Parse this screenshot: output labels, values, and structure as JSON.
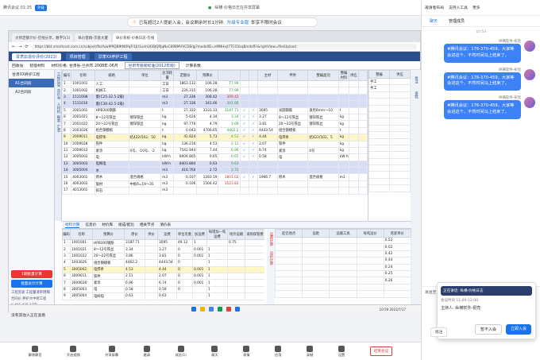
{
  "meeting": {
    "app_title": "腾讯会议 01:35",
    "mode_badge": "外链",
    "title": "纵横·价格日志在共享屏幕",
    "status_dot": "●"
  },
  "banner": {
    "text": "已有超过2人提前入会，会议剩余时长1分钟.",
    "link": "升级专业版",
    "suffix": "即享不限时会议"
  },
  "browser": {
    "tabs": [
      "大师定额计价-在线分享，数字5(1)",
      "纵价客群-京基大厦",
      "纵价系统-价格日志-在线"
    ],
    "url": "https://bbt.smartcost.com.cn/subject/fkzYuw9f9QB9tNOfqFr1JU1unhUG8JQRJqNxC89BMVVCDB/gj?modelID=nMNHxjt7TCO1kqBmdxfFr&rightView=file/Upload",
    "app_tabs": [
      "甘肃云造价评价(2021)",
      "项目管理",
      "甘肃XX养护工程"
    ],
    "toolbar": {
      "items": [
        "回收站",
        "智能材料",
        "材料价格: 甘肃省-兰州市 2008年-06月",
        "计算系数"
      ],
      "selector": "甘肃专版新标准(2012年版)"
    }
  },
  "left_panel": {
    "nodes": [
      "甘肃XX养护工程",
      "A1合同段",
      "A2合同段"
    ],
    "vtabs": [
      "工程信息",
      "造价书",
      "人材机",
      "报表",
      "汇总"
    ],
    "buttons": {
      "bind": "1期批量计算",
      "batch": "批量总计计算"
    },
    "info": [
      "工程资源 工程量清单明细",
      "合同价 养护大中修工程",
      "¥ 401,425.17元"
    ],
    "tip": "没有其他人正在查看"
  },
  "grid": {
    "headers": [
      "编号",
      "名称",
      "规格",
      "单位",
      "总消耗量",
      "定额价",
      "预算价",
      "",
      "",
      "",
      "主材",
      "甲供",
      "整编类别",
      "整编材料",
      "供应"
    ],
    "rows": [
      {
        "cls": "",
        "c": [
          "1",
          "1001001",
          "人工",
          "",
          "工日",
          "1863.132",
          "106.28",
          "77.99",
          "",
          "",
          "",
          "",
          "",
          "",
          "",
          ""
        ]
      },
      {
        "cls": "",
        "c": [
          "2",
          "1001002",
          "机械工",
          "",
          "工日",
          "226.315",
          "106.28",
          "77.99",
          "",
          "",
          "",
          "",
          "",
          "",
          "",
          ""
        ]
      },
      {
        "cls": "pur",
        "c": [
          "3",
          "1511008",
          "菱(C25-32.5-2级)",
          "",
          "m3",
          "27.336",
          "308.42",
          "309.42",
          "",
          "",
          "",
          "",
          "",
          "",
          "",
          ""
        ]
      },
      {
        "cls": "pur",
        "c": [
          "4",
          "1511010",
          "菱(C30-42.5-2级)",
          "",
          "m3",
          "27.336",
          "341.66",
          "341.66",
          "",
          "",
          "",
          "",
          "",
          "",
          "",
          ""
        ]
      },
      {
        "cls": "",
        "c": [
          "5",
          "2001001",
          "HPB300钢筋",
          "",
          "t",
          "27.332",
          "3333.33",
          "3187.71",
          "✓",
          "✓",
          "3095",
          "光圆钢筋",
          "直径8mm～10",
          "t",
          "",
          ""
        ]
      },
      {
        "cls": "",
        "c": [
          "6",
          "2001021",
          "8～12号铁丝",
          "镀锌铁丝",
          "kg",
          "5.626",
          "4.34",
          "3.34",
          "✓",
          "✓",
          "3.27",
          "8～12号铁丝",
          "镀锌铁丝",
          "kg",
          "",
          ""
        ]
      },
      {
        "cls": "",
        "c": [
          "7",
          "2001022",
          "20～22号铁丝",
          "镀锌铁丝",
          "kg",
          "97.770",
          "4.79",
          "3.69",
          "✓",
          "✓",
          "3.81",
          "20～22号铁丝",
          "镀锌铁丝",
          "kg",
          "",
          ""
        ]
      },
      {
        "cls": "",
        "c": [
          "8",
          "2003026",
          "组合钢模板",
          "",
          "t",
          "0.043",
          "4706.65",
          "4462.2",
          "✓",
          "✓",
          "4443.54",
          "组合钢模板",
          "",
          "t",
          "",
          ""
        ]
      },
      {
        "cls": "yel",
        "c": [
          "9",
          "2009011",
          "电焊条",
          "结422(502、50",
          "kg",
          "41.824",
          "5.73",
          "4.53",
          "✓",
          "✓",
          "4.44",
          "电焊条",
          "结422(502、5",
          "kg",
          "",
          ""
        ]
      },
      {
        "cls": "",
        "c": [
          "10",
          "2009028",
          "铁件",
          "",
          "kg",
          "136.216",
          "4.53",
          "2.11",
          "✓",
          "✓",
          "2.07",
          "铁件",
          "",
          "kg",
          "",
          ""
        ]
      },
      {
        "cls": "",
        "c": [
          "11",
          "2009033",
          "紧涂",
          "0号、-10号、-2",
          "kg",
          "7541.944",
          "7.44",
          "6.96",
          "✓",
          "✓",
          "6.74",
          "紧涂",
          "0号",
          "kg",
          "",
          ""
        ]
      },
      {
        "cls": "",
        "c": [
          "12",
          "3005002",
          "电",
          "",
          "kW·h",
          "8004.805",
          "0.65",
          "0.65",
          "✓",
          "✓",
          "0.58",
          "电",
          "",
          "kW·h",
          "",
          ""
        ]
      },
      {
        "cls": "pur",
        "c": [
          "13",
          "3005003",
          "电网电",
          "",
          "kW·h",
          "8403.884",
          "0.63",
          "0.63",
          "",
          "",
          "",
          "",
          "",
          "",
          "",
          ""
        ]
      },
      {
        "cls": "pur",
        "c": [
          "14",
          "3005004",
          "水",
          "",
          "m3",
          "416.760",
          "2.72",
          "2.72",
          "",
          "",
          "",
          "",
          "",
          "",
          "",
          ""
        ]
      },
      {
        "cls": "",
        "c": [
          "15",
          "4003001",
          "原木",
          "混合规格",
          "m3",
          "0.107",
          "1283.19",
          "1801.02",
          "✓",
          "✓",
          "1966.7",
          "原木",
          "混合规格",
          "m3",
          "",
          ""
        ]
      },
      {
        "cls": "",
        "c": [
          "16",
          "4003002",
          "锯材",
          "中板δ=19～35",
          "m3",
          "0.106",
          "1504.42",
          "1523.83",
          "",
          "",
          "",
          "",
          "",
          "",
          "",
          ""
        ]
      },
      {
        "cls": "",
        "c": [
          "17",
          "4013001",
          "碎石",
          "",
          "m3",
          "",
          "",
          "",
          "",
          "",
          "",
          "",
          "",
          "",
          "",
          ""
        ]
      }
    ]
  },
  "right_grid": {
    "headers": [
      "整编",
      "供应"
    ],
    "rows": [
      [
        "手工",
        ""
      ],
      [
        "手工",
        ""
      ],
      [
        "",
        ""
      ],
      [
        "",
        ""
      ],
      [
        "",
        ""
      ],
      [
        "",
        ""
      ],
      [
        "",
        ""
      ],
      [
        "",
        ""
      ],
      [
        "",
        ""
      ],
      [
        "",
        ""
      ],
      [
        "",
        ""
      ],
      [
        "",
        ""
      ],
      [
        "",
        ""
      ],
      [
        "",
        ""
      ],
      [
        "",
        ""
      ],
      [
        "",
        ""
      ],
      [
        "",
        ""
      ]
    ]
  },
  "right_sidebar": [
    "批注",
    "查找"
  ],
  "subtabs": [
    "材料计算",
    "信息价",
    "材价库",
    "组成/配比",
    "相关节点",
    "清价表"
  ],
  "subgrid": {
    "headers": [
      "编码",
      "名称",
      "预算价",
      "原价",
      "供价",
      "运费",
      "单位毛重",
      "加运费",
      "每增加一吨运费",
      "场外运输",
      "采购保管费"
    ],
    "rows": [
      [
        "1",
        "1001001",
        "HPB300钢筋",
        "3187.71",
        "",
        "3095",
        "49.12",
        "1",
        "",
        "0.75",
        ""
      ],
      [
        "2",
        "1001021",
        "8～12号铁丝",
        "3.34",
        "",
        "3.27",
        "0",
        "0.001",
        "1",
        "",
        ""
      ],
      [
        "3",
        "1001022",
        "20～22号铁丝",
        "3.86",
        "",
        "3.81",
        "0",
        "0.001",
        "1",
        "",
        ""
      ],
      [
        "4",
        "1003026",
        "组合钢模板",
        "4462.2",
        "",
        "4443.54",
        "0",
        "",
        "1",
        "",
        ""
      ],
      [
        "5",
        "3005002",
        "电焊条",
        "4.53",
        "",
        "4.44",
        "0",
        "0.001",
        "1",
        "",
        ""
      ],
      [
        "6",
        "3009011",
        "铁件",
        "2.11",
        "",
        "2.07",
        "0",
        "0.001",
        "1",
        "",
        ""
      ],
      [
        "7",
        "3009028",
        "紧涂",
        "6.96",
        "",
        "6.74",
        "0",
        "0.001",
        "1",
        "",
        ""
      ],
      [
        "8",
        "3005003",
        "电",
        "0.58",
        "",
        "0.58",
        "0",
        "",
        "1",
        "",
        ""
      ],
      [
        "9",
        "3005004",
        "电网电",
        "0.63",
        "",
        "0.63",
        "",
        "",
        "1",
        "",
        ""
      ]
    ]
  },
  "subside": [
    "运费计算",
    "运价计算"
  ],
  "subright": {
    "headers": [
      "起讫地点",
      "运距",
      "运输工具",
      "每吨运价",
      "装卸单价"
    ],
    "rows": [
      [
        "",
        "",
        "",
        "",
        "0.52"
      ],
      [
        "",
        "",
        "",
        "",
        "0.02"
      ],
      [
        "",
        "",
        "",
        "",
        "0.42"
      ],
      [
        "",
        "",
        "",
        "",
        "0.44"
      ],
      [
        "",
        "",
        "",
        "",
        "0.24"
      ],
      [
        "",
        "",
        "",
        "",
        "0.25"
      ],
      [
        "",
        "",
        "",
        "",
        "0.26"
      ],
      [
        "",
        "",
        "",
        "",
        ""
      ],
      [
        "",
        "",
        "",
        "",
        ""
      ]
    ]
  },
  "taskbar": {
    "time": "10:59",
    "date": "2023/7/17"
  },
  "chat": {
    "top": [
      "邀请者布局",
      "支持人工具",
      "更多"
    ],
    "tabs": [
      "聊天",
      "管理成员"
    ],
    "time": "10:54",
    "messages": [
      {
        "name": "纵横软件-祝亮",
        "text": "#腾讯会议：176-370-459，大家等会进这个，不然时间马上结束了。"
      },
      {
        "name": "纵横软件-祝亮",
        "text": "#腾讯会议：176-370-459，大家等会进这个，不然时间马上结束了。"
      },
      {
        "name": "纵横软件-祝亮",
        "text": "#腾讯会议：176-370-459，大家等会进这个，不然时间马上结束了。"
      }
    ],
    "send_to": "发送至",
    "send": "发送"
  },
  "popup": {
    "status": "正在讲话: 纵横·价格日志",
    "meeting_time": "会议时间 11:00-12:00",
    "host": "主持人: 纵横软件-祝亮",
    "no_join": "暂不入会",
    "join": "立即入会"
  },
  "rightbar": {
    "annotate": "批注",
    "end": "结束会议"
  },
  "controls": [
    {
      "label": "解除静音"
    },
    {
      "label": "开启视频"
    },
    {
      "label": "共享屏幕"
    },
    {
      "label": "邀请"
    },
    {
      "label": "成员(1)"
    },
    {
      "label": "聊天"
    },
    {
      "label": "表情"
    },
    {
      "label": "应用"
    },
    {
      "label": "录制"
    },
    {
      "label": "设置"
    }
  ]
}
